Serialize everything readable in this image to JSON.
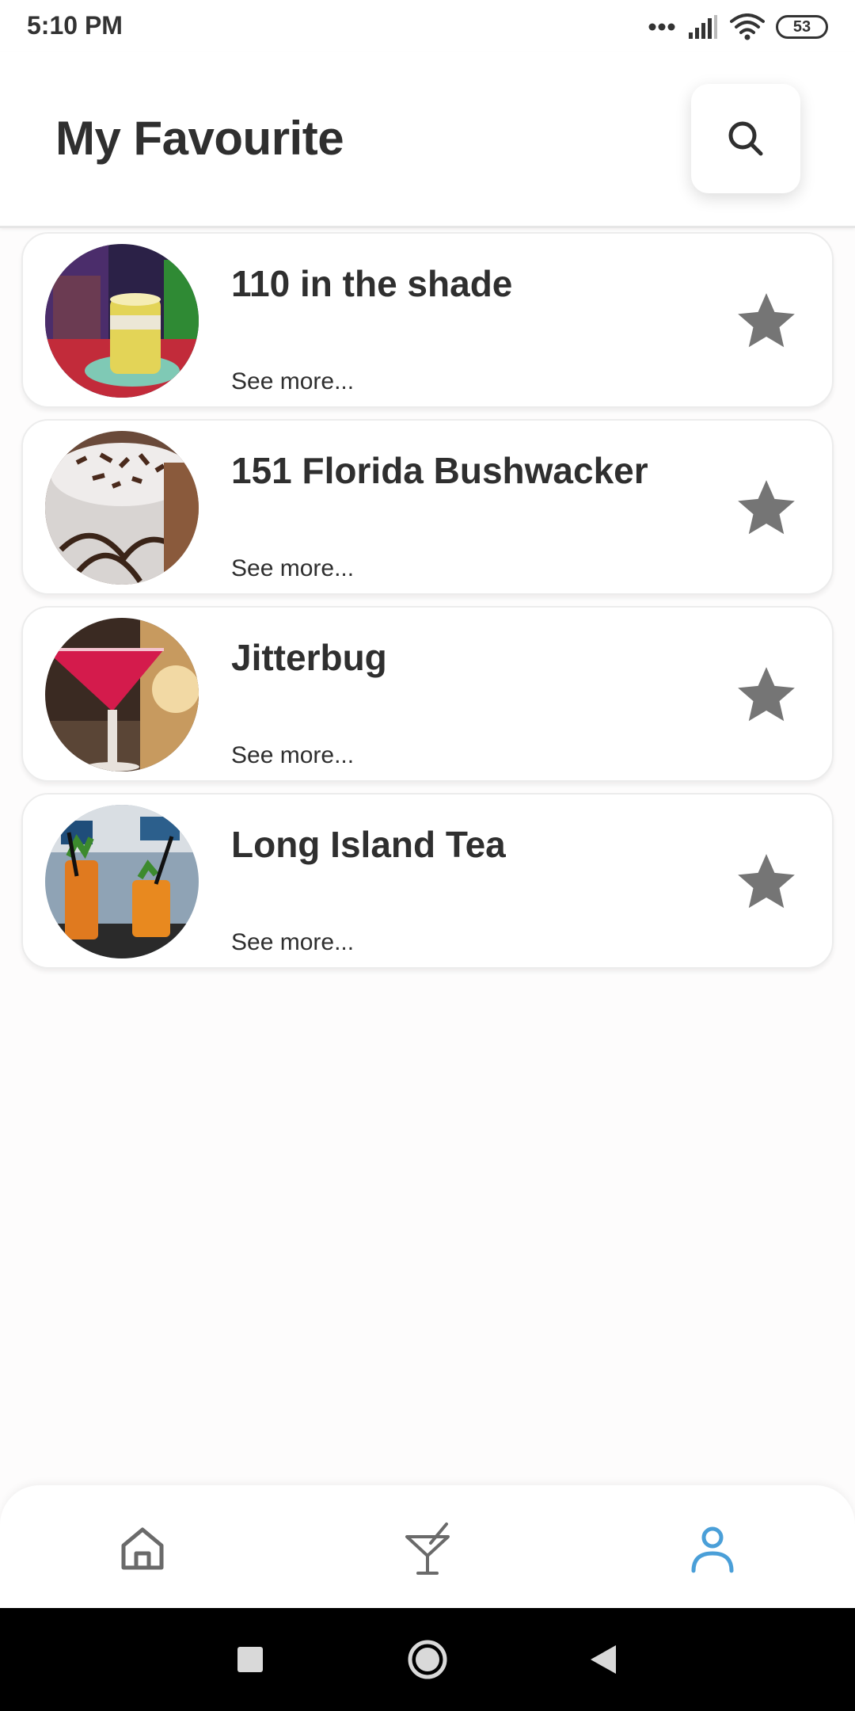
{
  "status_bar": {
    "time": "5:10 PM",
    "battery": "53"
  },
  "header": {
    "title": "My Favourite"
  },
  "favourites": [
    {
      "name": "110 in the shade",
      "link": "See more..."
    },
    {
      "name": "151 Florida Bushwacker",
      "link": "See more..."
    },
    {
      "name": "Jitterbug",
      "link": "See more..."
    },
    {
      "name": "Long Island Tea",
      "link": "See more..."
    }
  ],
  "colors": {
    "accent": "#4a9fd8",
    "star": "#757575",
    "text": "#2f2f2f"
  },
  "icons": {
    "search": "search-icon",
    "star": "star-icon",
    "home": "home-icon",
    "cocktail": "cocktail-icon",
    "profile": "profile-icon"
  },
  "bottom_nav": {
    "active": "profile"
  }
}
